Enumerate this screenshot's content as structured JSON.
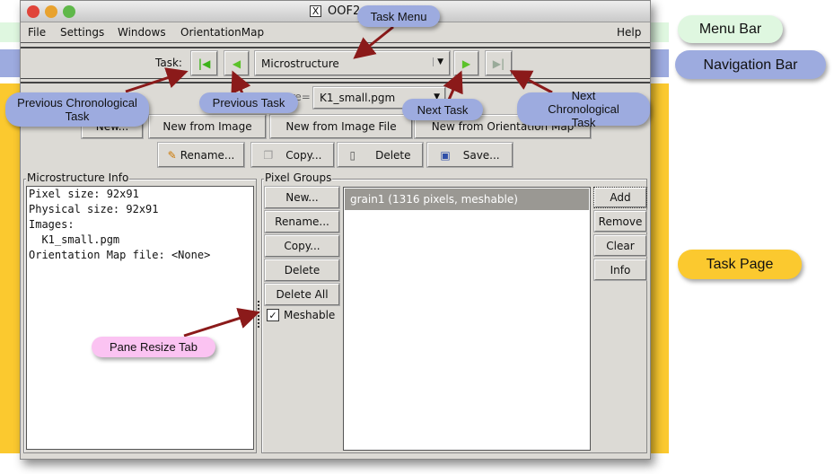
{
  "window": {
    "title": "OOF2"
  },
  "menu": {
    "items": [
      "File",
      "Settings",
      "Windows",
      "OrientationMap"
    ],
    "help": "Help"
  },
  "nav": {
    "task_label": "Task:",
    "task_value": "Microstructure"
  },
  "page": {
    "ms_label": "Microstructure=",
    "ms_value": "K1_small.pgm",
    "row1": [
      "New...",
      "New from Image",
      "New from Image File",
      "New from Orientation Map"
    ],
    "row2": [
      "Rename...",
      "Copy...",
      "Delete",
      "Save..."
    ],
    "info_title": "Microstructure Info",
    "info_lines": [
      "Pixel size: 92x91",
      "Physical size: 92x91",
      "Images:",
      "  K1_small.pgm",
      "Orientation Map file: <None>"
    ],
    "pg_title": "Pixel Groups",
    "pg_buttons": [
      "New...",
      "Rename...",
      "Copy...",
      "Delete",
      "Delete All"
    ],
    "meshable": "Meshable",
    "meshable_checked": true,
    "groups": [
      "grain1 (1316 pixels, meshable)"
    ],
    "list_buttons": [
      "Add",
      "Remove",
      "Clear",
      "Info"
    ]
  },
  "annotations": {
    "menu_bar": "Menu Bar",
    "navigation_bar": "Navigation Bar",
    "task_page": "Task Page",
    "task_menu": "Task Menu",
    "prev_chrono": "Previous Chronological Task",
    "prev_task": "Previous Task",
    "next_task": "Next Task",
    "next_chrono": "Next Chronological Task",
    "pane_resize": "Pane Resize Tab"
  },
  "colors": {
    "menu_band": "#dff7e0",
    "nav_band": "#9dabdf",
    "page_band": "#fbc92f",
    "pane_pill": "#fbc3f2",
    "arrow": "#8b1a1a"
  }
}
